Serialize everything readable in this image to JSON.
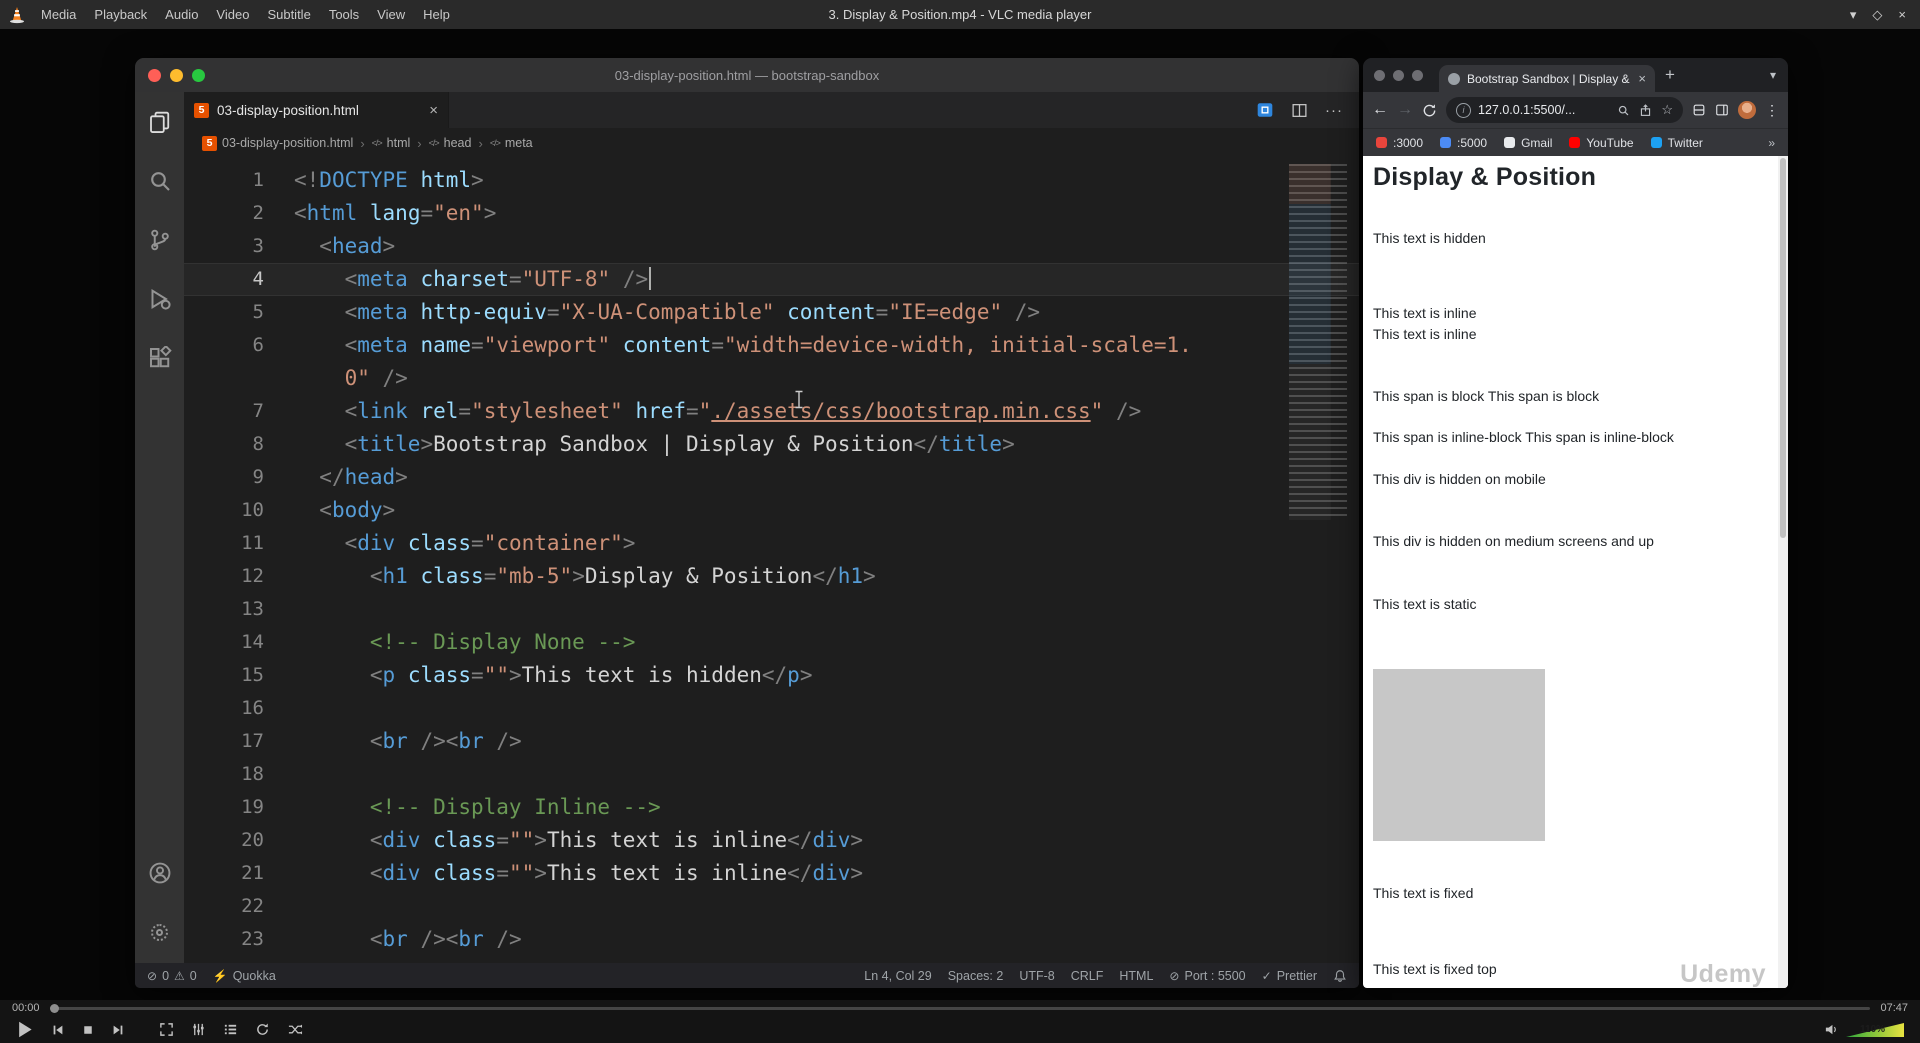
{
  "icons": {
    "close": "×",
    "chevron_down": "▾",
    "maximize_diamond": "◇",
    "plus": "+",
    "overflow_chevrons": "»",
    "more_dots": "···",
    "kebab": "⋮",
    "star": "☆",
    "back_arrow": "←",
    "forward_arrow": "→",
    "error_circle": "⊘",
    "warning_triangle": "⚠",
    "lightning": "⚡",
    "check": "✓",
    "breadcrumb_sep": "›",
    "port_circle": "⊘",
    "info_i": "i"
  },
  "vlc": {
    "window_title": "3. Display & Position.mp4 - VLC media player",
    "menus": [
      "Media",
      "Playback",
      "Audio",
      "Video",
      "Subtitle",
      "Tools",
      "View",
      "Help"
    ],
    "elapsed": "00:00",
    "duration": "07:47",
    "volume_label": "110%"
  },
  "vscode": {
    "window_title": "03-display-position.html — bootstrap-sandbox",
    "tab_label": "03-display-position.html",
    "breadcrumbs": [
      "03-display-position.html",
      "html",
      "head",
      "meta"
    ],
    "status": {
      "errors": "0",
      "warnings": "0",
      "quokka": "Quokka",
      "line_col": "Ln 4, Col 29",
      "spaces": "Spaces: 2",
      "encoding": "UTF-8",
      "eol": "CRLF",
      "language": "HTML",
      "port": "Port : 5500",
      "formatter": "Prettier"
    },
    "editor_lines": [
      {
        "n": "1",
        "s": [
          [
            "p",
            "<!"
          ],
          [
            "t",
            "DOCTYPE"
          ],
          [
            "a",
            " html"
          ],
          [
            "p",
            ">"
          ]
        ]
      },
      {
        "n": "2",
        "s": [
          [
            "p",
            "<"
          ],
          [
            "t",
            "html"
          ],
          [
            "x",
            " "
          ],
          [
            "a",
            "lang"
          ],
          [
            "p",
            "="
          ],
          [
            "s",
            "\"en\""
          ],
          [
            "p",
            ">"
          ]
        ]
      },
      {
        "n": "3",
        "s": [
          [
            "x",
            "  "
          ],
          [
            "p",
            "<"
          ],
          [
            "t",
            "head"
          ],
          [
            "p",
            ">"
          ]
        ]
      },
      {
        "n": "4",
        "active": true,
        "cursor": true,
        "s": [
          [
            "x",
            "    "
          ],
          [
            "p",
            "<"
          ],
          [
            "t",
            "meta"
          ],
          [
            "x",
            " "
          ],
          [
            "a",
            "charset"
          ],
          [
            "p",
            "="
          ],
          [
            "s",
            "\"UTF-8\""
          ],
          [
            "x",
            " "
          ],
          [
            "p",
            "/>"
          ]
        ]
      },
      {
        "n": "5",
        "s": [
          [
            "x",
            "    "
          ],
          [
            "p",
            "<"
          ],
          [
            "t",
            "meta"
          ],
          [
            "x",
            " "
          ],
          [
            "a",
            "http-equiv"
          ],
          [
            "p",
            "="
          ],
          [
            "s",
            "\"X-UA-Compatible\""
          ],
          [
            "x",
            " "
          ],
          [
            "a",
            "content"
          ],
          [
            "p",
            "="
          ],
          [
            "s",
            "\"IE=edge\""
          ],
          [
            "x",
            " "
          ],
          [
            "p",
            "/>"
          ]
        ]
      },
      {
        "n": "6",
        "s": [
          [
            "x",
            "    "
          ],
          [
            "p",
            "<"
          ],
          [
            "t",
            "meta"
          ],
          [
            "x",
            " "
          ],
          [
            "a",
            "name"
          ],
          [
            "p",
            "="
          ],
          [
            "s",
            "\"viewport\""
          ],
          [
            "x",
            " "
          ],
          [
            "a",
            "content"
          ],
          [
            "p",
            "="
          ],
          [
            "s",
            "\"width=device-width, initial-scale=1."
          ]
        ]
      },
      {
        "n": "",
        "s": [
          [
            "x",
            "    "
          ],
          [
            "s",
            "0\""
          ],
          [
            "x",
            " "
          ],
          [
            "p",
            "/>"
          ]
        ]
      },
      {
        "n": "7",
        "s": [
          [
            "x",
            "    "
          ],
          [
            "p",
            "<"
          ],
          [
            "t",
            "link"
          ],
          [
            "x",
            " "
          ],
          [
            "a",
            "rel"
          ],
          [
            "p",
            "="
          ],
          [
            "s",
            "\"stylesheet\""
          ],
          [
            "x",
            " "
          ],
          [
            "a",
            "href"
          ],
          [
            "p",
            "="
          ],
          [
            "s",
            "\""
          ],
          [
            "l",
            "./assets/css/bootstrap.min.css"
          ],
          [
            "s",
            "\""
          ],
          [
            "x",
            " "
          ],
          [
            "p",
            "/>"
          ]
        ]
      },
      {
        "n": "8",
        "s": [
          [
            "x",
            "    "
          ],
          [
            "p",
            "<"
          ],
          [
            "t",
            "title"
          ],
          [
            "p",
            ">"
          ],
          [
            "x",
            "Bootstrap Sandbox | Display & Position"
          ],
          [
            "p",
            "</"
          ],
          [
            "t",
            "title"
          ],
          [
            "p",
            ">"
          ]
        ]
      },
      {
        "n": "9",
        "s": [
          [
            "x",
            "  "
          ],
          [
            "p",
            "</"
          ],
          [
            "t",
            "head"
          ],
          [
            "p",
            ">"
          ]
        ]
      },
      {
        "n": "10",
        "s": [
          [
            "x",
            "  "
          ],
          [
            "p",
            "<"
          ],
          [
            "t",
            "body"
          ],
          [
            "p",
            ">"
          ]
        ]
      },
      {
        "n": "11",
        "s": [
          [
            "x",
            "    "
          ],
          [
            "p",
            "<"
          ],
          [
            "t",
            "div"
          ],
          [
            "x",
            " "
          ],
          [
            "a",
            "class"
          ],
          [
            "p",
            "="
          ],
          [
            "s",
            "\"container\""
          ],
          [
            "p",
            ">"
          ]
        ]
      },
      {
        "n": "12",
        "s": [
          [
            "x",
            "      "
          ],
          [
            "p",
            "<"
          ],
          [
            "t",
            "h1"
          ],
          [
            "x",
            " "
          ],
          [
            "a",
            "class"
          ],
          [
            "p",
            "="
          ],
          [
            "s",
            "\"mb-5\""
          ],
          [
            "p",
            ">"
          ],
          [
            "x",
            "Display & Position"
          ],
          [
            "p",
            "</"
          ],
          [
            "t",
            "h1"
          ],
          [
            "p",
            ">"
          ]
        ]
      },
      {
        "n": "13",
        "s": []
      },
      {
        "n": "14",
        "s": [
          [
            "x",
            "      "
          ],
          [
            "c",
            "<!-- Display None -->"
          ]
        ]
      },
      {
        "n": "15",
        "s": [
          [
            "x",
            "      "
          ],
          [
            "p",
            "<"
          ],
          [
            "t",
            "p"
          ],
          [
            "x",
            " "
          ],
          [
            "a",
            "class"
          ],
          [
            "p",
            "="
          ],
          [
            "s",
            "\"\""
          ],
          [
            "p",
            ">"
          ],
          [
            "x",
            "This text is hidden"
          ],
          [
            "p",
            "</"
          ],
          [
            "t",
            "p"
          ],
          [
            "p",
            ">"
          ]
        ]
      },
      {
        "n": "16",
        "s": []
      },
      {
        "n": "17",
        "s": [
          [
            "x",
            "      "
          ],
          [
            "p",
            "<"
          ],
          [
            "t",
            "br"
          ],
          [
            "x",
            " "
          ],
          [
            "p",
            "/>"
          ],
          [
            "p",
            "<"
          ],
          [
            "t",
            "br"
          ],
          [
            "x",
            " "
          ],
          [
            "p",
            "/>"
          ]
        ]
      },
      {
        "n": "18",
        "s": []
      },
      {
        "n": "19",
        "s": [
          [
            "x",
            "      "
          ],
          [
            "c",
            "<!-- Display Inline -->"
          ]
        ]
      },
      {
        "n": "20",
        "s": [
          [
            "x",
            "      "
          ],
          [
            "p",
            "<"
          ],
          [
            "t",
            "div"
          ],
          [
            "x",
            " "
          ],
          [
            "a",
            "class"
          ],
          [
            "p",
            "="
          ],
          [
            "s",
            "\"\""
          ],
          [
            "p",
            ">"
          ],
          [
            "x",
            "This text is inline"
          ],
          [
            "p",
            "</"
          ],
          [
            "t",
            "div"
          ],
          [
            "p",
            ">"
          ]
        ]
      },
      {
        "n": "21",
        "s": [
          [
            "x",
            "      "
          ],
          [
            "p",
            "<"
          ],
          [
            "t",
            "div"
          ],
          [
            "x",
            " "
          ],
          [
            "a",
            "class"
          ],
          [
            "p",
            "="
          ],
          [
            "s",
            "\"\""
          ],
          [
            "p",
            ">"
          ],
          [
            "x",
            "This text is inline"
          ],
          [
            "p",
            "</"
          ],
          [
            "t",
            "div"
          ],
          [
            "p",
            ">"
          ]
        ]
      },
      {
        "n": "22",
        "s": []
      },
      {
        "n": "23",
        "s": [
          [
            "x",
            "      "
          ],
          [
            "p",
            "<"
          ],
          [
            "t",
            "br"
          ],
          [
            "x",
            " "
          ],
          [
            "p",
            "/>"
          ],
          [
            "p",
            "<"
          ],
          [
            "t",
            "br"
          ],
          [
            "x",
            " "
          ],
          [
            "p",
            "/>"
          ]
        ]
      }
    ]
  },
  "chrome": {
    "tab_title": "Bootstrap Sandbox | Display &",
    "url": "127.0.0.1:5500/...",
    "bookmarks": [
      {
        "label": ":3000",
        "color": "#e8453c"
      },
      {
        "label": ":5000",
        "color": "#4c8bf5"
      },
      {
        "label": "Gmail",
        "color": "#e8eaed"
      },
      {
        "label": "YouTube",
        "color": "#ff0000"
      },
      {
        "label": "Twitter",
        "color": "#1da1f2"
      }
    ],
    "page": {
      "heading": "Display & Position",
      "items": [
        {
          "type": "text",
          "text": "This text is hidden"
        },
        {
          "type": "text",
          "text": "This text is inline"
        },
        {
          "type": "text",
          "text": "This text is inline"
        },
        {
          "type": "text",
          "text": "This span is block This span is block"
        },
        {
          "type": "text",
          "text": "This span is inline-block This span is inline-block"
        },
        {
          "type": "text",
          "text": "This div is hidden on mobile"
        },
        {
          "type": "text",
          "text": "This div is hidden on medium screens and up"
        },
        {
          "type": "text",
          "text": "This text is static"
        },
        {
          "type": "box"
        },
        {
          "type": "text",
          "text": "This text is fixed"
        },
        {
          "type": "text",
          "text": "This text is fixed top"
        }
      ]
    },
    "watermark": "Udemy"
  }
}
